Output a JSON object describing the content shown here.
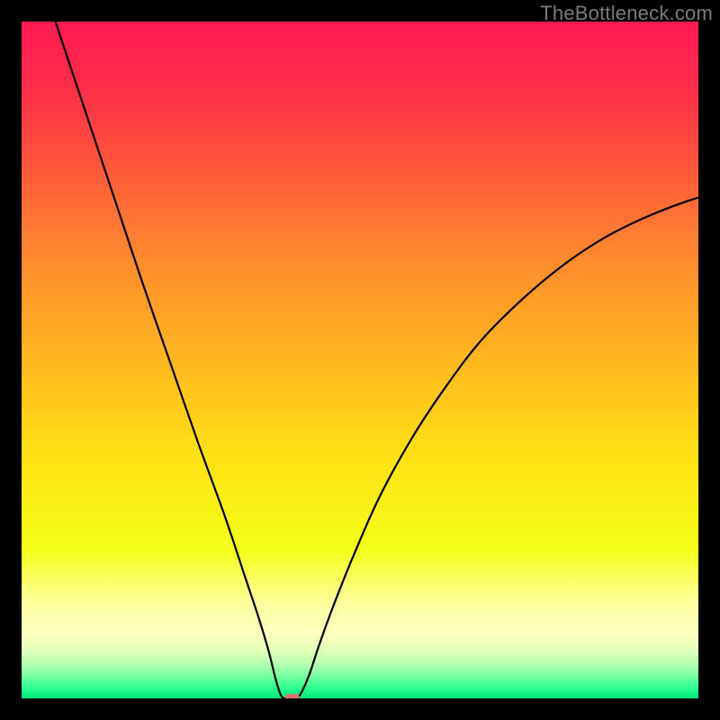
{
  "watermark": "TheBottleneck.com",
  "chart_data": {
    "type": "line",
    "title": "",
    "xlabel": "",
    "ylabel": "",
    "xlim": [
      0,
      100
    ],
    "ylim": [
      0,
      100
    ],
    "grid": false,
    "legend": false,
    "notch": {
      "x": 39,
      "y": 0
    },
    "marker": {
      "x": 40,
      "y": 0,
      "color": "#d9736f"
    },
    "series": [
      {
        "name": "curve",
        "color": "#000000",
        "points": [
          {
            "x": 5.0,
            "y": 100.0
          },
          {
            "x": 7.0,
            "y": 94.0
          },
          {
            "x": 10.0,
            "y": 85.0
          },
          {
            "x": 14.0,
            "y": 73.0
          },
          {
            "x": 18.0,
            "y": 61.0
          },
          {
            "x": 22.0,
            "y": 49.5
          },
          {
            "x": 26.0,
            "y": 38.0
          },
          {
            "x": 30.0,
            "y": 27.0
          },
          {
            "x": 33.0,
            "y": 18.0
          },
          {
            "x": 35.0,
            "y": 12.0
          },
          {
            "x": 36.5,
            "y": 7.0
          },
          {
            "x": 37.5,
            "y": 3.0
          },
          {
            "x": 38.3,
            "y": 0.5
          },
          {
            "x": 39.0,
            "y": 0.0
          },
          {
            "x": 40.5,
            "y": 0.0
          },
          {
            "x": 41.3,
            "y": 0.8
          },
          {
            "x": 42.5,
            "y": 3.5
          },
          {
            "x": 44.0,
            "y": 8.0
          },
          {
            "x": 46.0,
            "y": 13.5
          },
          {
            "x": 49.0,
            "y": 21.0
          },
          {
            "x": 53.0,
            "y": 30.0
          },
          {
            "x": 58.0,
            "y": 39.0
          },
          {
            "x": 63.0,
            "y": 46.5
          },
          {
            "x": 68.0,
            "y": 53.0
          },
          {
            "x": 74.0,
            "y": 59.0
          },
          {
            "x": 80.0,
            "y": 64.0
          },
          {
            "x": 86.0,
            "y": 68.0
          },
          {
            "x": 92.0,
            "y": 71.0
          },
          {
            "x": 97.0,
            "y": 73.0
          },
          {
            "x": 100.0,
            "y": 74.0
          }
        ]
      }
    ],
    "background_gradient": {
      "stops": [
        {
          "offset": 0.0,
          "color": "#ff1a53"
        },
        {
          "offset": 0.1,
          "color": "#ff2e49"
        },
        {
          "offset": 0.22,
          "color": "#ff5a3a"
        },
        {
          "offset": 0.35,
          "color": "#ff8a2e"
        },
        {
          "offset": 0.5,
          "color": "#ffb720"
        },
        {
          "offset": 0.65,
          "color": "#ffe314"
        },
        {
          "offset": 0.78,
          "color": "#f4ff1a"
        },
        {
          "offset": 0.86,
          "color": "#ffff9e"
        },
        {
          "offset": 0.905,
          "color": "#fdffc0"
        },
        {
          "offset": 0.925,
          "color": "#e8ffb8"
        },
        {
          "offset": 0.945,
          "color": "#c2ffb4"
        },
        {
          "offset": 0.965,
          "color": "#7effa4"
        },
        {
          "offset": 0.985,
          "color": "#2bff90"
        },
        {
          "offset": 1.0,
          "color": "#00e57a"
        }
      ]
    }
  }
}
